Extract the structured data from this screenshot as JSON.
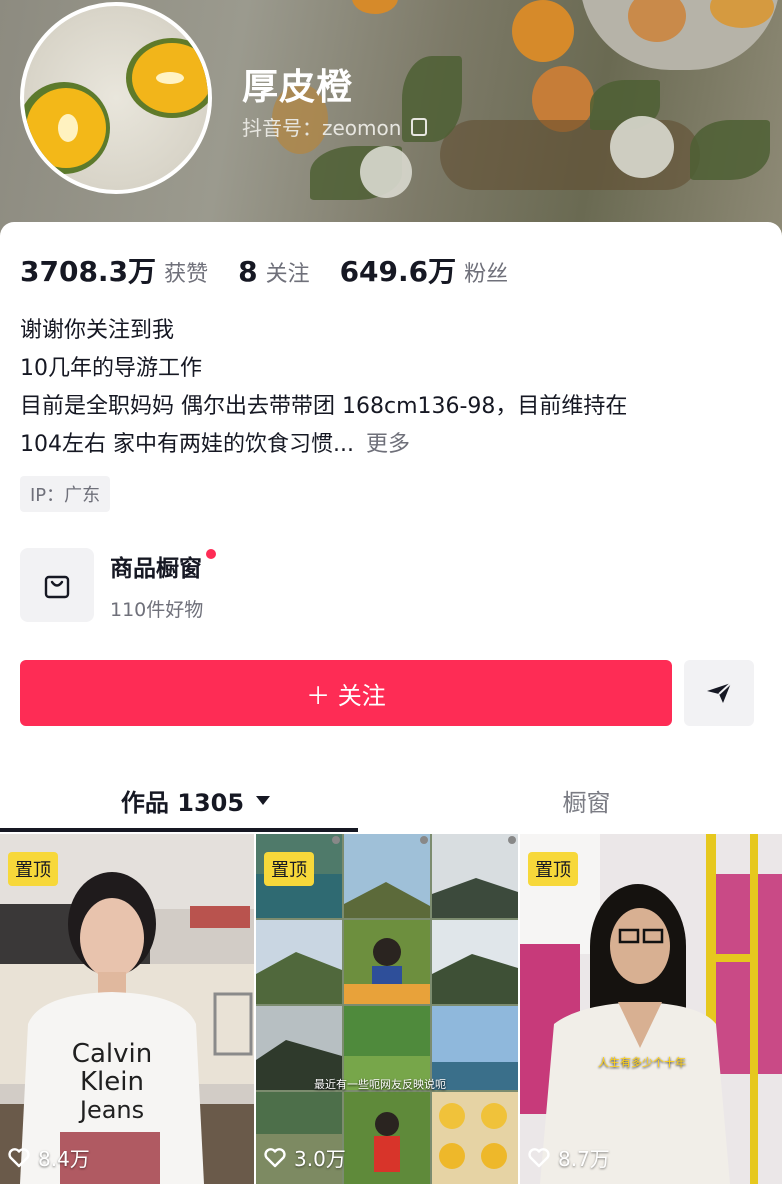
{
  "profile": {
    "nickname": "厚皮橙",
    "douyin_id": "抖音号：zeomon"
  },
  "stats": {
    "likes_num": "3708.3万",
    "likes_label": "获赞",
    "following_num": "8",
    "following_label": "关注",
    "followers_num": "649.6万",
    "followers_label": "粉丝"
  },
  "bio": {
    "line1": "谢谢你关注到我",
    "line2": "10几年的导游工作",
    "line3": "目前是全职妈妈 偶尔出去带带团 168cm136-98，目前维持在",
    "line4": "104左右 家中有两娃的饮食习惯...",
    "more": "更多"
  },
  "ip": "IP：广东",
  "shop": {
    "title": "商品橱窗",
    "subtitle": "110件好物"
  },
  "actions": {
    "follow_label": "＋ 关注"
  },
  "tabs": {
    "works": "作品 1305",
    "window": "橱窗"
  },
  "videos": [
    {
      "pinned": "置顶",
      "likes": "8.4万"
    },
    {
      "pinned": "置顶",
      "likes": "3.0万",
      "caption": "最近有一些呃网友反映说呃"
    },
    {
      "pinned": "置顶",
      "likes": "8.7万",
      "caption": "人生有多少个十年"
    }
  ],
  "colors": {
    "accent": "#fe2c55",
    "pin_badge": "#f7d83a",
    "text_primary": "#161823",
    "text_secondary": "#6f707a"
  },
  "icons": {
    "shop": "shopping-bag-icon",
    "share": "share-arrow-icon",
    "copy": "copy-icon",
    "heart": "heart-icon",
    "dropdown": "caret-down-icon"
  }
}
